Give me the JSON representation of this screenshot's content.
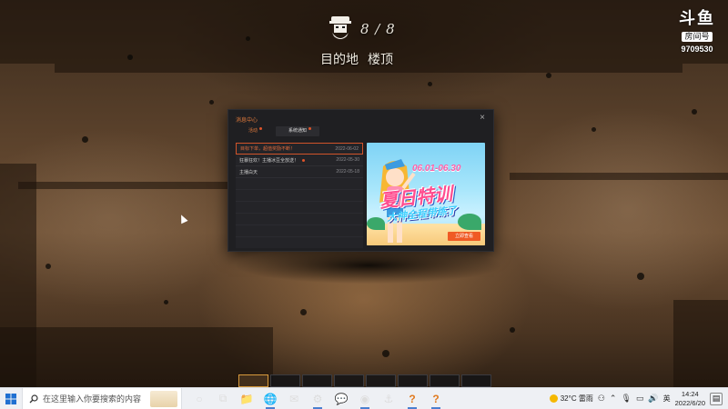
{
  "hud": {
    "counter": "8 / 8",
    "destination_label": "目的地",
    "destination_value": "楼顶"
  },
  "watermark": {
    "logo": "斗鱼",
    "tag": "房间号",
    "room": "9709530"
  },
  "dialog": {
    "title": "消息中心",
    "close": "×",
    "tabs": [
      {
        "label": "活动",
        "active": true
      },
      {
        "label": "系统通知",
        "active": false
      }
    ],
    "messages": [
      {
        "title": "目标下单，超值奖励不断！",
        "date": "2022-06-02",
        "unread": false,
        "selected": true
      },
      {
        "title": "狂暴狂欢！主播冰豆全放送！",
        "date": "2022-05-30",
        "unread": true,
        "selected": false
      },
      {
        "title": "主播白天",
        "date": "2022-05-18",
        "unread": false,
        "selected": false
      }
    ],
    "banner": {
      "date_range": "06.01-06.30",
      "headline": "夏日特训",
      "subline": "大神全程带练了",
      "cta": "立即查看"
    }
  },
  "taskbar": {
    "search_placeholder": "在这里输入你要搜索的内容",
    "apps": [
      {
        "icon": "cortana-icon",
        "glyph": "○"
      },
      {
        "icon": "task-view-icon",
        "glyph": "⧉"
      },
      {
        "icon": "file-explorer-icon",
        "glyph": "📁"
      },
      {
        "icon": "edge-icon",
        "glyph": "🌐"
      },
      {
        "icon": "mail-icon",
        "glyph": "✉"
      },
      {
        "icon": "steam-icon",
        "glyph": "⚙"
      },
      {
        "icon": "wechat-icon",
        "glyph": "💬"
      },
      {
        "icon": "game-launcher-icon",
        "glyph": "◉"
      },
      {
        "icon": "anchor-app-icon",
        "glyph": "⚓"
      },
      {
        "icon": "orange-app-icon-1",
        "glyph": "?"
      },
      {
        "icon": "orange-app-icon-2",
        "glyph": "?"
      }
    ],
    "weather": "32°C 雷雨",
    "ime": "英",
    "time": "14:24",
    "date": "2022/6/20"
  }
}
